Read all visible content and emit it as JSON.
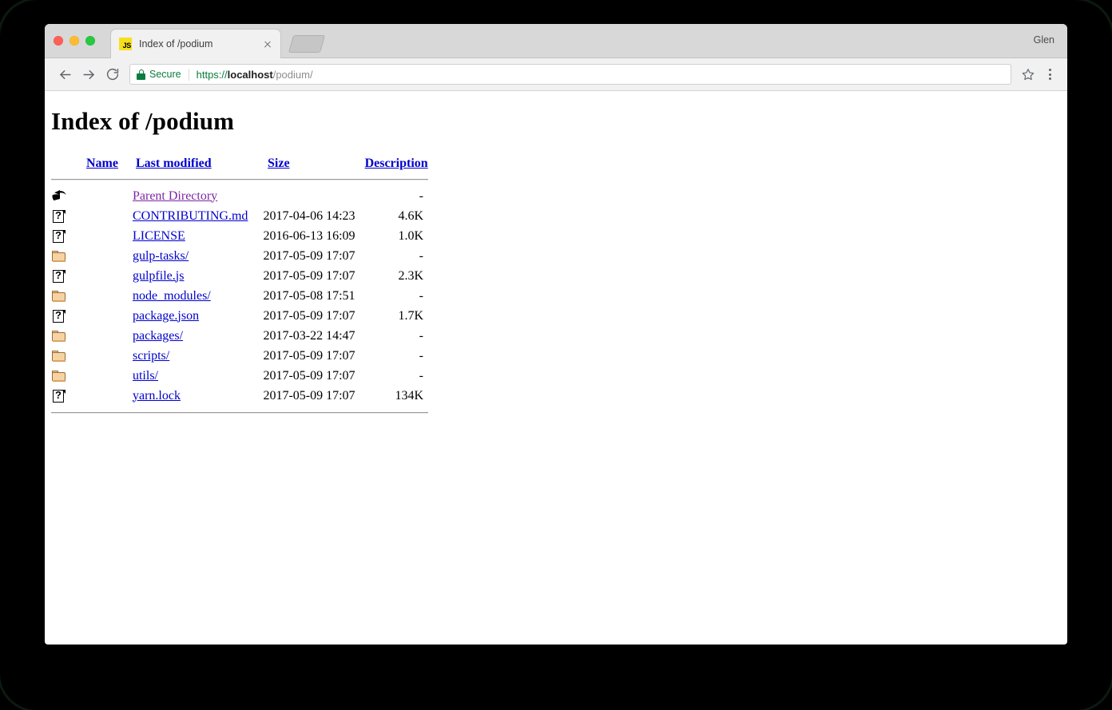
{
  "browser": {
    "traffic_lights": [
      "close",
      "minimize",
      "zoom"
    ],
    "tab": {
      "favicon_text": "JS",
      "favicon_name": "javascript-favicon",
      "title": "Index of /podium",
      "close_label": "×"
    },
    "new_tab_label": "",
    "profile_name": "Glen",
    "toolbar": {
      "back_label": "Back",
      "forward_label": "Forward",
      "reload_label": "Reload",
      "security_label": "Secure",
      "url_scheme": "https://",
      "url_host": "localhost",
      "url_path": "/podium/",
      "url_full": "https://localhost/podium/",
      "star_label": "Bookmark this page",
      "menu_label": "Customize and control Google Chrome"
    }
  },
  "page": {
    "title": "Index of /podium",
    "table": {
      "headers": [
        {
          "label": "Name",
          "key": "name"
        },
        {
          "label": "Last modified",
          "key": "modified"
        },
        {
          "label": "Size",
          "key": "size"
        },
        {
          "label": "Description",
          "key": "description"
        }
      ],
      "rows": [
        {
          "icon": "back",
          "name": "Parent Directory",
          "modified": "",
          "size": "-",
          "description": "",
          "visited": true
        },
        {
          "icon": "doc",
          "name": "CONTRIBUTING.md",
          "modified": "2017-04-06 14:23",
          "size": "4.6K",
          "description": "",
          "visited": false
        },
        {
          "icon": "doc",
          "name": "LICENSE",
          "modified": "2016-06-13 16:09",
          "size": "1.0K",
          "description": "",
          "visited": false
        },
        {
          "icon": "folder",
          "name": "gulp-tasks/",
          "modified": "2017-05-09 17:07",
          "size": "-",
          "description": "",
          "visited": false
        },
        {
          "icon": "doc",
          "name": "gulpfile.js",
          "modified": "2017-05-09 17:07",
          "size": "2.3K",
          "description": "",
          "visited": false
        },
        {
          "icon": "folder",
          "name": "node_modules/",
          "modified": "2017-05-08 17:51",
          "size": "-",
          "description": "",
          "visited": false
        },
        {
          "icon": "doc",
          "name": "package.json",
          "modified": "2017-05-09 17:07",
          "size": "1.7K",
          "description": "",
          "visited": false
        },
        {
          "icon": "folder",
          "name": "packages/",
          "modified": "2017-03-22 14:47",
          "size": "-",
          "description": "",
          "visited": false
        },
        {
          "icon": "folder",
          "name": "scripts/",
          "modified": "2017-05-09 17:07",
          "size": "-",
          "description": "",
          "visited": false
        },
        {
          "icon": "folder",
          "name": "utils/",
          "modified": "2017-05-09 17:07",
          "size": "-",
          "description": "",
          "visited": false
        },
        {
          "icon": "doc",
          "name": "yarn.lock",
          "modified": "2017-05-09 17:07",
          "size": "134K",
          "description": "",
          "visited": false
        }
      ]
    }
  },
  "colors": {
    "link": "#0000cc",
    "link_visited": "#7d27a5",
    "secure_green": "#0b7d3e",
    "favicon_yellow": "#f7df1e",
    "folder_fill": "#f6d3a3",
    "bezel": "#000000"
  }
}
